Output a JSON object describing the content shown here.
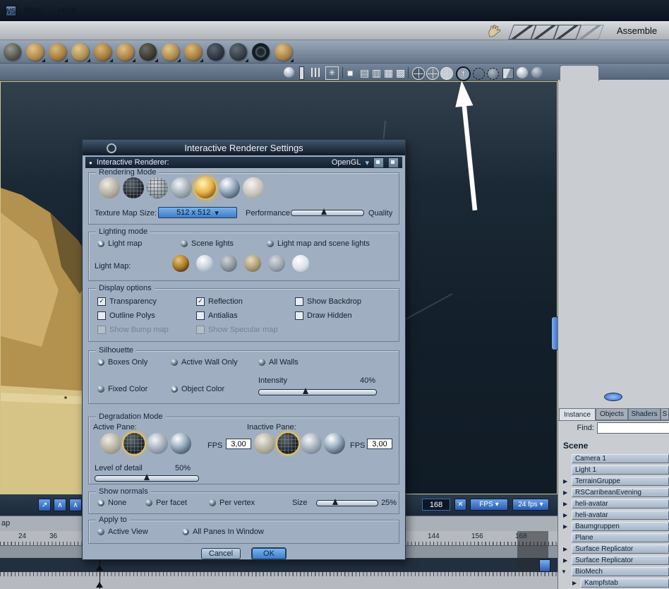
{
  "menubar": {
    "items": [
      "ws",
      "Web",
      "Help"
    ],
    "assemble_label": "Assemble"
  },
  "glyphs": {
    "check": "✓",
    "chevron": "▾",
    "up_arrow": "↑",
    "close_x": "✕",
    "collapsed": "▶",
    "expanded": "▼",
    "bullet": "●",
    "pane_single": "■",
    "pane_h": "▤",
    "pane_v": "▥",
    "pane_grid": "▦",
    "pane_quad": "▩",
    "star": "✳",
    "tl_btn_1": "↗",
    "tl_btn_2": "∧",
    "tl_btn_3": "∧"
  },
  "dialog": {
    "title": "Interactive Renderer Settings",
    "renderer_label": "Interactive Renderer:",
    "renderer_value": "OpenGL",
    "rendering_mode": {
      "label": "Rendering Mode",
      "texture_label": "Texture Map Size:",
      "texture_value": "512 x  512",
      "performance_label": "Performance",
      "quality_label": "Quality"
    },
    "lighting": {
      "label": "Lighting mode",
      "opt1": "Light map",
      "opt2": "Scene lights",
      "opt3": "Light map and scene lights",
      "light_map_label": "Light Map:"
    },
    "display": {
      "label": "Display options",
      "cb": [
        "Transparency",
        "Reflection",
        "Show Backdrop",
        "Outline Polys",
        "Antialias",
        "Draw Hidden",
        "Show Bump map",
        "Show Specular map"
      ]
    },
    "silhouette": {
      "label": "Silhouette",
      "opt1": "Boxes Only",
      "opt2": "Active Wall Only",
      "opt3": "All Walls",
      "intensity_label": "Intensity",
      "intensity_value": "40%",
      "color1": "Fixed Color",
      "color2": "Object Color"
    },
    "degradation": {
      "label": "Degradation Mode",
      "active_label": "Active Pane:",
      "inactive_label": "Inactive Pane:",
      "fps_label": "FPS",
      "active_fps": "3,00",
      "inactive_fps": "3,00",
      "lod_label": "Level of detail",
      "lod_value": "50%"
    },
    "normals": {
      "label": "Show normals",
      "opt1": "None",
      "opt2": "Per facet",
      "opt3": "Per vertex",
      "size_label": "Size",
      "size_value": "25%"
    },
    "apply": {
      "label": "Apply to",
      "opt1": "Active View",
      "opt2": "All Panes In Window"
    },
    "cancel": "Cancel",
    "ok": "OK"
  },
  "sidebar": {
    "tabs": [
      "Instance",
      "Objects",
      "Shaders",
      "S"
    ],
    "find_label": "Find:",
    "scene_label": "Scene",
    "items": [
      {
        "label": "Camera 1"
      },
      {
        "label": "Light 1"
      },
      {
        "label": "TerrainGruppe"
      },
      {
        "label": "RSCarribeanEvening"
      },
      {
        "label": "heli-avatar"
      },
      {
        "label": "heli-avatar"
      },
      {
        "label": "Baumgruppen"
      },
      {
        "label": "Plane"
      },
      {
        "label": "Surface Replicator"
      },
      {
        "label": "Surface Replicator"
      },
      {
        "label": "BioMech"
      },
      {
        "label": "Kampfstab"
      }
    ]
  },
  "timeline": {
    "frame_value": "168",
    "fps_label": "FPS",
    "fps_value": "24 fps",
    "partial_label": "ap",
    "ruler": [
      "24",
      "36",
      "144",
      "156",
      "168"
    ]
  }
}
